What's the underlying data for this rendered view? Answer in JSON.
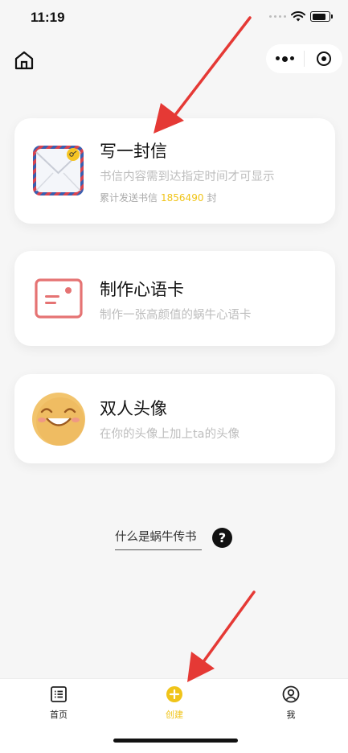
{
  "status_bar": {
    "time": "11:19"
  },
  "cards": [
    {
      "title": "写一封信",
      "subtitle": "书信内容需到达指定时间才可显示",
      "stat_prefix": "累计发送书信",
      "stat_count": "1856490",
      "stat_suffix": "封"
    },
    {
      "title": "制作心语卡",
      "subtitle": "制作一张高颜值的蜗牛心语卡"
    },
    {
      "title": "双人头像",
      "subtitle": "在你的头像上加上ta的头像"
    }
  ],
  "help": {
    "link_text": "什么是蜗牛传书",
    "icon_text": "?"
  },
  "tabbar": [
    {
      "label": "首页",
      "icon": "list-icon",
      "active": false
    },
    {
      "label": "创建",
      "icon": "plus-circle-icon",
      "active": true
    },
    {
      "label": "我",
      "icon": "user-icon",
      "active": false
    }
  ],
  "colors": {
    "accent": "#f0c419",
    "annotation_arrow": "#e53935",
    "card_icon_red": "#e57373"
  }
}
